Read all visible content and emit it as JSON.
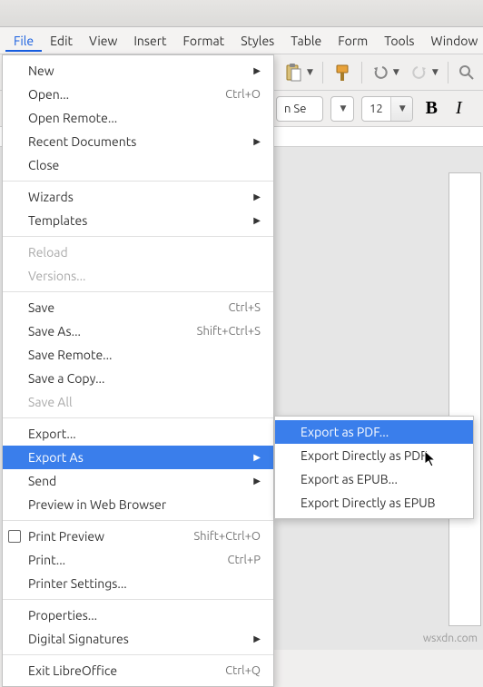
{
  "menubar": {
    "file": "File",
    "edit": "Edit",
    "view": "View",
    "insert": "Insert",
    "format": "Format",
    "styles": "Styles",
    "table": "Table",
    "form": "Form",
    "tools": "Tools",
    "window": "Window"
  },
  "toolbar": {
    "font_name_visible": "n Se",
    "font_size": "12",
    "bold_glyph": "B",
    "italic_glyph": "I"
  },
  "file_menu": {
    "new": "New",
    "open": "Open...",
    "open_accel": "Ctrl+O",
    "open_remote": "Open Remote...",
    "recent": "Recent Documents",
    "close": "Close",
    "wizards": "Wizards",
    "templates": "Templates",
    "reload": "Reload",
    "versions": "Versions...",
    "save": "Save",
    "save_accel": "Ctrl+S",
    "save_as": "Save As...",
    "save_as_accel": "Shift+Ctrl+S",
    "save_remote": "Save Remote...",
    "save_copy": "Save a Copy...",
    "save_all": "Save All",
    "export": "Export...",
    "export_as": "Export As",
    "send": "Send",
    "preview_web": "Preview in Web Browser",
    "print_preview": "Print Preview",
    "print_preview_accel": "Shift+Ctrl+O",
    "print": "Print...",
    "print_accel": "Ctrl+P",
    "printer_settings": "Printer Settings...",
    "properties": "Properties...",
    "digital_sig": "Digital Signatures",
    "exit": "Exit LibreOffice",
    "exit_accel": "Ctrl+Q"
  },
  "export_submenu": {
    "as_pdf": "Export as PDF...",
    "direct_pdf": "Export Directly as PDF",
    "as_epub": "Export as EPUB...",
    "direct_epub": "Export Directly as EPUB"
  },
  "watermark": "wsxdn.com"
}
